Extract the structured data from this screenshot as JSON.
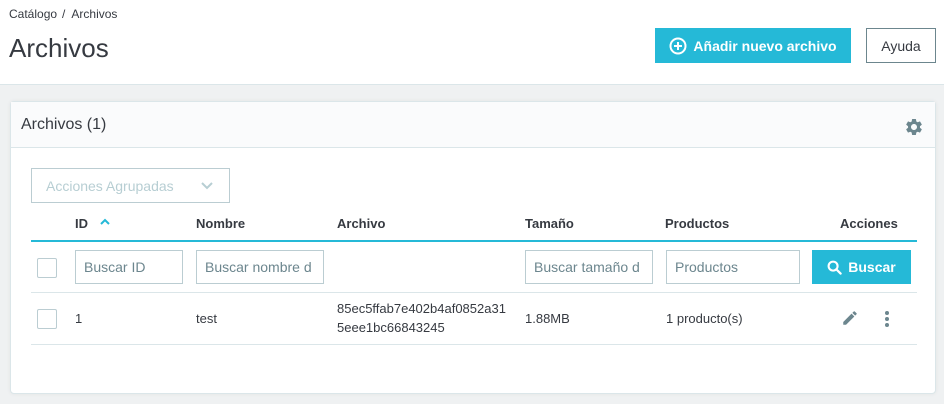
{
  "breadcrumb": {
    "items": [
      "Catálogo",
      "Archivos"
    ],
    "separator": "/"
  },
  "page": {
    "title": "Archivos"
  },
  "toolbar": {
    "add_label": "Añadir nuevo archivo",
    "help_label": "Ayuda"
  },
  "card": {
    "title": "Archivos (1)",
    "bulk_label": "Acciones Agrupadas"
  },
  "table": {
    "columns": {
      "id": "ID",
      "name": "Nombre",
      "file": "Archivo",
      "size": "Tamaño",
      "products": "Productos",
      "actions": "Acciones"
    },
    "filters": {
      "id_placeholder": "Buscar ID",
      "name_placeholder": "Buscar nombre d",
      "size_placeholder": "Buscar tamaño d",
      "products_placeholder": "Productos",
      "search_label": "Buscar"
    },
    "rows": [
      {
        "id": "1",
        "name": "test",
        "file_line1": "85ec5ffab7e402b4af0852a31",
        "file_line2": "5eee1bc66843245",
        "size": "1.88MB",
        "products": "1 producto(s)"
      }
    ]
  },
  "colors": {
    "accent": "#25b9d7",
    "text": "#363a41",
    "border": "#bbcdd2",
    "muted": "#6c868e"
  },
  "icons": [
    "plus-circle-icon",
    "gear-icon",
    "chevron-down-icon",
    "sort-up-icon",
    "search-icon",
    "pencil-icon",
    "more-vertical-icon"
  ]
}
